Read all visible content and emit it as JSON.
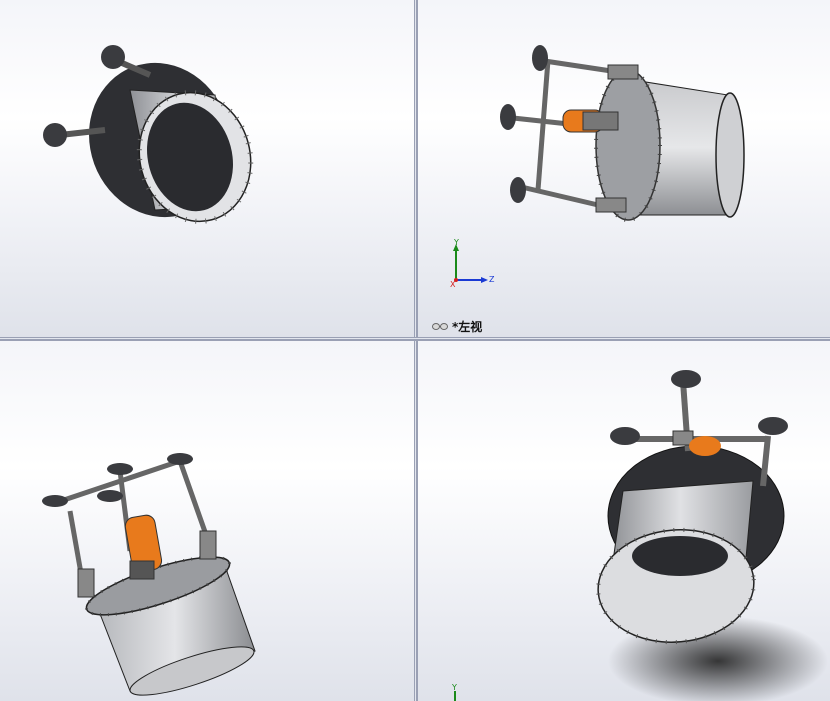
{
  "window": {
    "layout": "four-viewport"
  },
  "viewports": {
    "top_left": {
      "view_label": ""
    },
    "top_right": {
      "view_label": "*左视",
      "triad": {
        "y": "Y",
        "z": "Z",
        "x": "X"
      }
    },
    "bottom_left": {
      "view_label": ""
    },
    "bottom_right": {
      "view_label": "",
      "triad": {
        "y": "Y"
      }
    }
  },
  "colors": {
    "viewport_top": "#f4f5f9",
    "viewport_bottom": "#dfe2ea",
    "divider": "#9aa0b4",
    "motor_orange": "#e87a1c",
    "steel_gray": "#b4b6ba",
    "dark_flange": "#2e2f33",
    "triad_y": "#1a8a1a",
    "triad_z": "#1a3ad4",
    "triad_x": "#d42020"
  },
  "icons": {
    "view_glasses": "glasses-icon"
  }
}
